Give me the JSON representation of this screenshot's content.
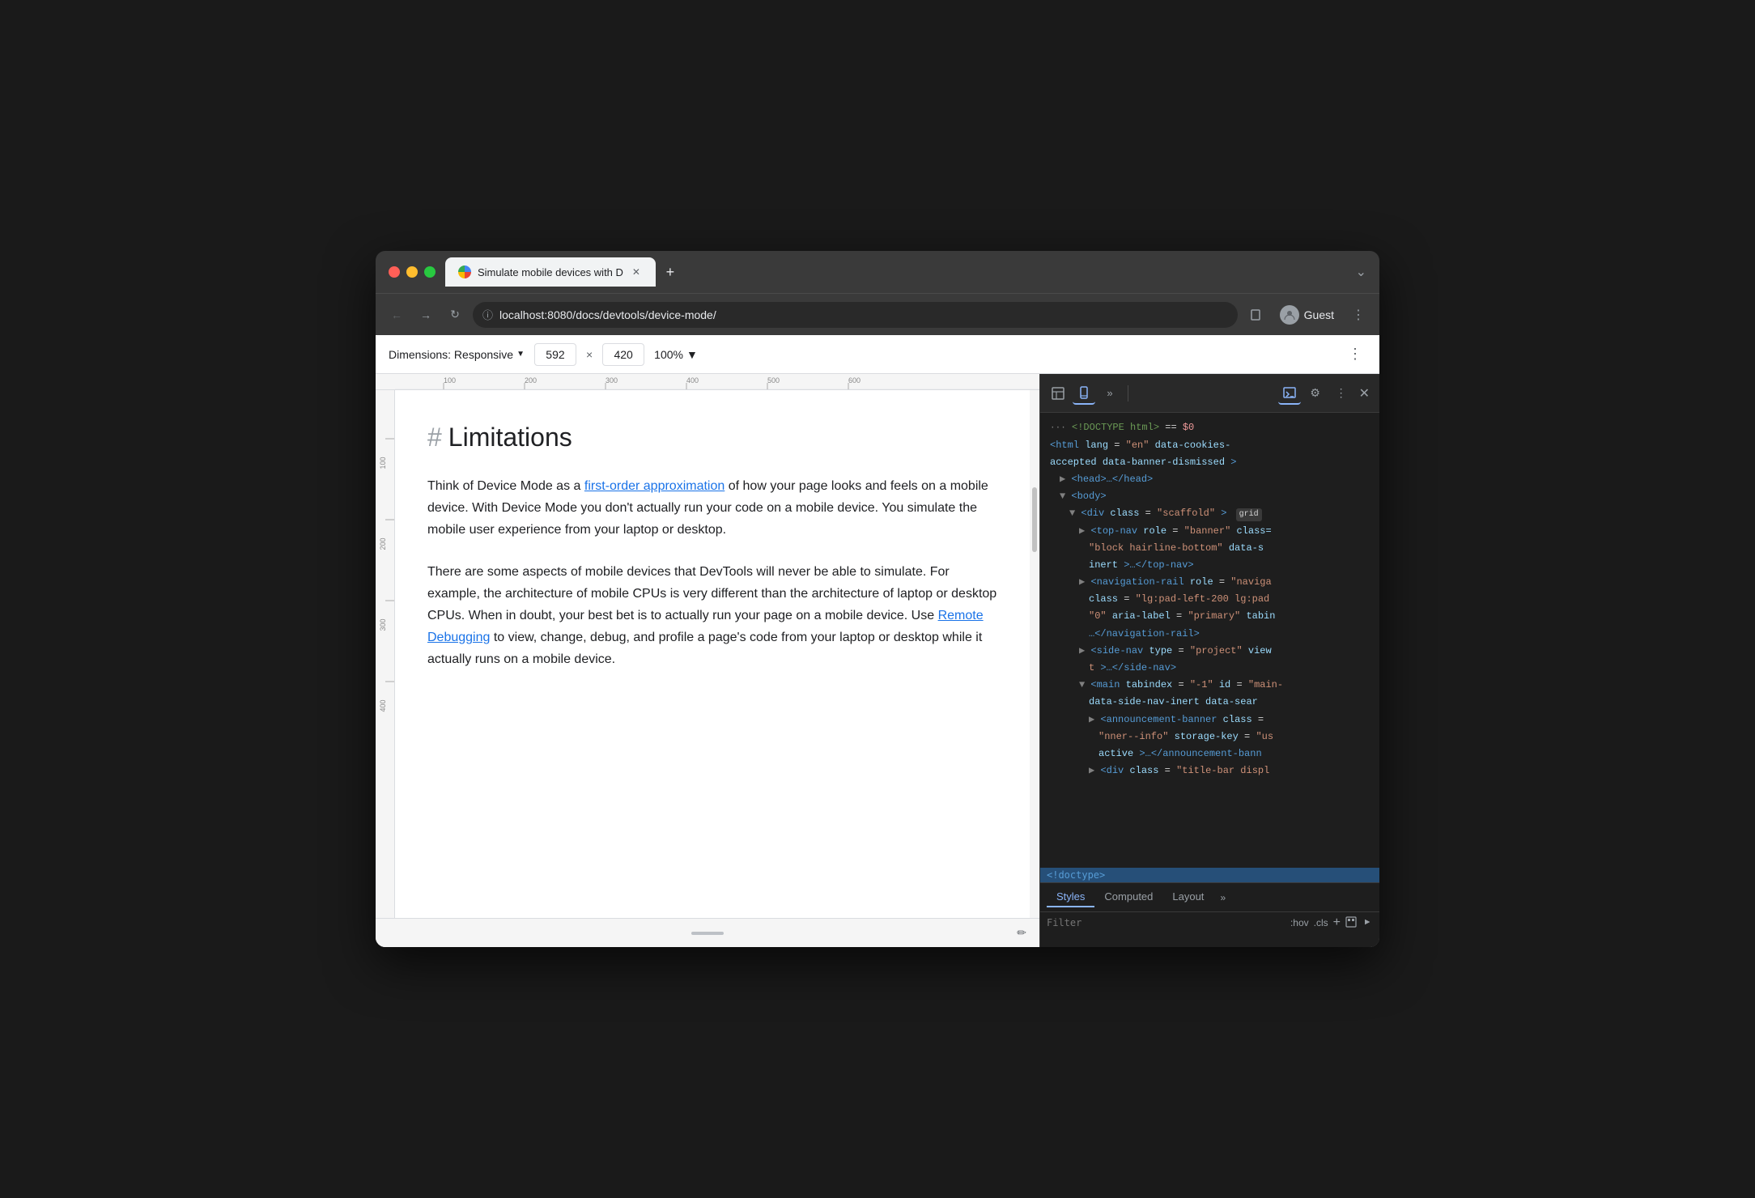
{
  "browser": {
    "tab_title": "Simulate mobile devices with D",
    "url": "localhost:8080/docs/devtools/device-mode/",
    "profile_label": "Guest",
    "new_tab_label": "+",
    "chevron": "⌄"
  },
  "device_toolbar": {
    "dimensions_label": "Dimensions: Responsive",
    "width_value": "592",
    "height_value": "420",
    "cross_label": "×",
    "zoom_label": "100%",
    "more_label": "⋮"
  },
  "page": {
    "heading_hash": "#",
    "heading": "Limitations",
    "paragraph1_start": "Think of Device Mode as a ",
    "paragraph1_link": "first-order approximation",
    "paragraph1_end": " of how your page looks and feels on a mobile device. With Device Mode you don't actually run your code on a mobile device. You simulate the mobile user experience from your laptop or desktop.",
    "paragraph2_start": "There are some aspects of mobile devices that DevTools will never be able to simulate. For example, the architecture of mobile CPUs is very different than the architecture of laptop or desktop CPUs. When in doubt, your best bet is to actually run your page on a mobile device. Use ",
    "paragraph2_link": "Remote Debugging",
    "paragraph2_end": " to view, change, debug, and profile a page's code from your laptop or desktop while it actually runs on a mobile device."
  },
  "ruler": {
    "ticks_h": [
      "100",
      "200",
      "300",
      "400",
      "500",
      "600"
    ],
    "ticks_v": [
      "100",
      "200",
      "300",
      "400"
    ]
  },
  "devtools": {
    "toolbar": {
      "inspector_icon": "⬚",
      "device_icon": "▣",
      "more_icon": "»",
      "console_icon": "≡",
      "settings_icon": "⚙",
      "options_icon": "⋮",
      "close_icon": "✕"
    },
    "dom": {
      "comment_line": "···<!DOCTYPE html> == $0",
      "lines": [
        {
          "indent": 1,
          "content": "<html lang=\"en\" data-cookies-accepted data-banner-dismissed>",
          "type": "tag"
        },
        {
          "indent": 2,
          "content": "▶ <head>…</head>",
          "type": "tag-collapsed"
        },
        {
          "indent": 2,
          "content": "▼ <body>",
          "type": "tag-open"
        },
        {
          "indent": 3,
          "content": "▼ <div class=\"scaffold\">",
          "type": "tag-open",
          "badge": "grid"
        },
        {
          "indent": 4,
          "content": "▶ <top-nav role=\"banner\" class=",
          "type": "tag-partial"
        },
        {
          "indent": 5,
          "content": "block hairline-bottom\" data-s",
          "type": "text"
        },
        {
          "indent": 5,
          "content": "inert>…</top-nav>",
          "type": "tag"
        },
        {
          "indent": 4,
          "content": "▶ <navigation-rail role=\"naviga",
          "type": "tag-partial"
        },
        {
          "indent": 5,
          "content": "class=\"lg:pad-left-200 lg:pad",
          "type": "text"
        },
        {
          "indent": 5,
          "content": "0\" aria-label=\"primary\" tabin",
          "type": "text"
        },
        {
          "indent": 5,
          "content": "…</navigation-rail>",
          "type": "tag"
        },
        {
          "indent": 4,
          "content": "▶ <side-nav type=\"project\" view",
          "type": "tag-partial"
        },
        {
          "indent": 5,
          "content": "t\">…</side-nav>",
          "type": "tag"
        },
        {
          "indent": 4,
          "content": "▼ <main tabindex=\"-1\" id=\"main-",
          "type": "tag-partial"
        },
        {
          "indent": 5,
          "content": "data-side-nav-inert data-sear",
          "type": "text"
        },
        {
          "indent": 5,
          "content": "▶ <announcement-banner class=",
          "type": "tag-partial"
        },
        {
          "indent": 6,
          "content": "nner--info\" storage-key=\"us",
          "type": "text"
        },
        {
          "indent": 6,
          "content": "active>…</announcement-bann",
          "type": "tag"
        },
        {
          "indent": 5,
          "content": "▶ <div class=\"title-bar displ",
          "type": "tag-partial"
        }
      ]
    },
    "styles": {
      "tabs": [
        "Styles",
        "Computed",
        "Layout",
        "»"
      ],
      "filter_placeholder": "Filter",
      "hov_label": ":hov",
      "cls_label": ".cls",
      "add_label": "+",
      "doctype_label": "<!doctype>"
    }
  }
}
